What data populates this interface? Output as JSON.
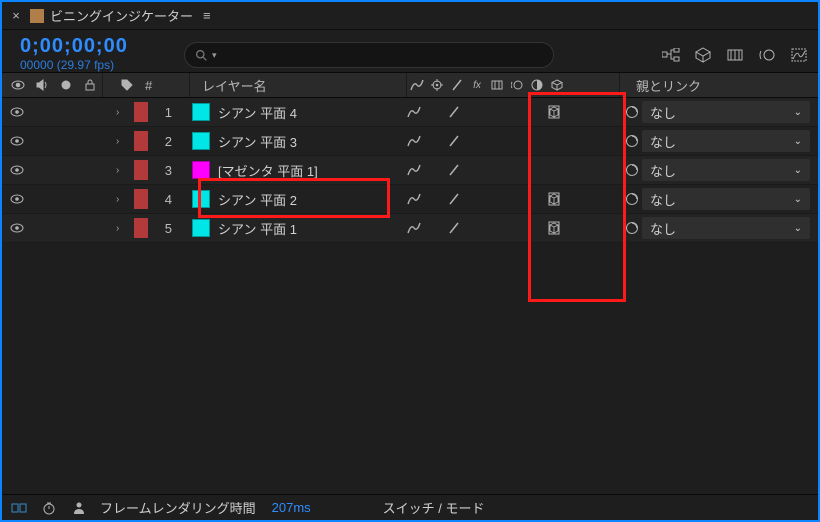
{
  "tab": {
    "close_glyph": "×",
    "title": "ビニングインジケーター",
    "menu_glyph": "≡"
  },
  "time": {
    "main": "0;00;00;00",
    "frames": "00000",
    "fps": "(29.97 fps)"
  },
  "search": {
    "placeholder": ""
  },
  "columns": {
    "layer_name": "レイヤー名",
    "parent": "親とリンク",
    "index_symbol": "#"
  },
  "switch_header_icons": [
    "shy",
    "star",
    "quality",
    "fx",
    "frameblend",
    "motionblur",
    "adjustment",
    "3d"
  ],
  "layers": [
    {
      "index": 1,
      "color": "#b23a3a",
      "swatch": "#00e5e5",
      "name": "シアン 平面 4",
      "bracket": false,
      "box3d": true,
      "parent": "なし"
    },
    {
      "index": 2,
      "color": "#b23a3a",
      "swatch": "#00e5e5",
      "name": "シアン 平面 3",
      "bracket": false,
      "box3d": false,
      "parent": "なし"
    },
    {
      "index": 3,
      "color": "#b23a3a",
      "swatch": "#ff00ff",
      "name": "[マゼンタ 平面 1]",
      "bracket": true,
      "box3d": false,
      "parent": "なし"
    },
    {
      "index": 4,
      "color": "#b23a3a",
      "swatch": "#00e5e5",
      "name": "シアン 平面 2",
      "bracket": false,
      "box3d": true,
      "parent": "なし"
    },
    {
      "index": 5,
      "color": "#b23a3a",
      "swatch": "#00e5e5",
      "name": "シアン 平面 1",
      "bracket": false,
      "box3d": true,
      "parent": "なし"
    }
  ],
  "footer": {
    "label": "フレームレンダリング時間",
    "value": "207ms",
    "mode": "スイッチ / モード"
  }
}
